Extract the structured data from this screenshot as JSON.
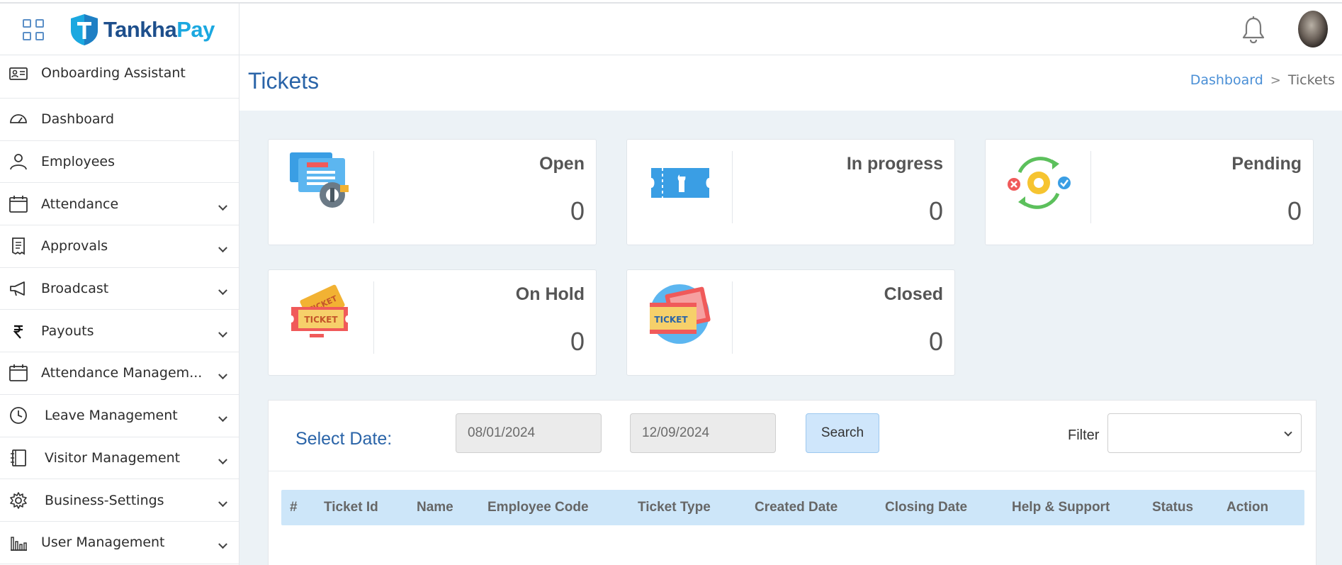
{
  "brand": {
    "name_part1": "Tankha",
    "name_part2": "Pay",
    "colors": {
      "navy": "#1e4f8c",
      "cyan": "#1ba8e0"
    }
  },
  "header": {
    "icons": [
      "apps-grid-icon",
      "bell-icon",
      "user-avatar"
    ]
  },
  "sidebar": {
    "items": [
      {
        "label": "Onboarding Assistant",
        "icon": "id-card-icon",
        "expandable": false
      },
      {
        "label": "Dashboard",
        "icon": "speedometer-icon",
        "expandable": false
      },
      {
        "label": "Employees",
        "icon": "user-icon",
        "expandable": false
      },
      {
        "label": "Attendance",
        "icon": "calendar-icon",
        "expandable": true
      },
      {
        "label": "Approvals",
        "icon": "receipt-icon",
        "expandable": true
      },
      {
        "label": "Broadcast",
        "icon": "megaphone-icon",
        "expandable": true
      },
      {
        "label": "Payouts",
        "icon": "rupee-icon",
        "expandable": true
      },
      {
        "label": "Attendance Managem...",
        "icon": "calendar-icon",
        "expandable": true
      },
      {
        "label": "Leave Management",
        "icon": "clock-icon",
        "expandable": true
      },
      {
        "label": "Visitor Management",
        "icon": "notebook-icon",
        "expandable": true
      },
      {
        "label": "Business-Settings",
        "icon": "gear-icon",
        "expandable": true
      },
      {
        "label": "User Management",
        "icon": "bar-chart-icon",
        "expandable": true
      }
    ]
  },
  "page": {
    "title": "Tickets",
    "breadcrumb": {
      "link": "Dashboard",
      "separator": ">",
      "current": "Tickets"
    }
  },
  "stats": [
    {
      "label": "Open",
      "value": "0",
      "icon": "ticket-settings-icon"
    },
    {
      "label": "In progress",
      "value": "0",
      "icon": "ticket-wrench-icon"
    },
    {
      "label": "Pending",
      "value": "0",
      "icon": "gear-cycle-icon"
    },
    {
      "label": "On Hold",
      "value": "0",
      "icon": "tickets-icon"
    },
    {
      "label": "Closed",
      "value": "0",
      "icon": "ticket-circle-icon"
    }
  ],
  "filters": {
    "select_date_label": "Select Date:",
    "from_date": "08/01/2024",
    "to_date": "12/09/2024",
    "search_label": "Search",
    "filter_label": "Filter",
    "filter_value": ""
  },
  "table": {
    "columns": [
      "#",
      "Ticket Id",
      "Name",
      "Employee Code",
      "Ticket Type",
      "Created Date",
      "Closing Date",
      "Help & Support",
      "Status",
      "Action"
    ],
    "rows": []
  },
  "colors": {
    "accent": "#2a64a8",
    "link": "#4a8fd6",
    "table_header_bg": "#cde6f9",
    "content_bg": "#ecf2f6"
  }
}
